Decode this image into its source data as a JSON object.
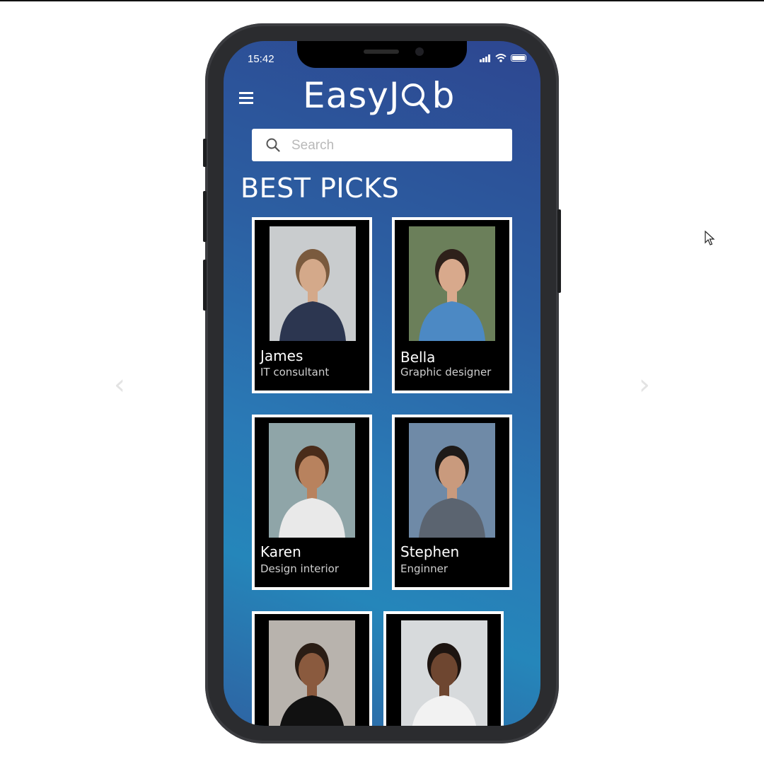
{
  "status": {
    "time": "15:42"
  },
  "app": {
    "logo": "EasyJob",
    "logo_prefix": "EasyJ",
    "logo_suffix": "b"
  },
  "search": {
    "placeholder": "Search",
    "value": ""
  },
  "section": {
    "title": "BEST PICKS"
  },
  "profiles": [
    {
      "name": "James",
      "role": "IT consultant",
      "photo_bg": "#c9ccce",
      "skin": "#d4a98a",
      "hair": "#7a5a3e",
      "shirt": "#2c3650"
    },
    {
      "name": "Bella",
      "role": "Graphic designer",
      "photo_bg": "#6b7f5a",
      "skin": "#d8a98c",
      "hair": "#2e201a",
      "shirt": "#4c89c4"
    },
    {
      "name": "Karen",
      "role": "Design interior",
      "photo_bg": "#8fa5a8",
      "skin": "#b8825e",
      "hair": "#4a2c1a",
      "shirt": "#e9e9e9"
    },
    {
      "name": "Stephen",
      "role": "Enginner",
      "photo_bg": "#6f8aa7",
      "skin": "#c99a7d",
      "hair": "#1e1a18",
      "shirt": "#5b6470"
    },
    {
      "name": "",
      "role": "",
      "photo_bg": "#b8b3ad",
      "skin": "#8a5a3e",
      "hair": "#2a1d15",
      "shirt": "#111111"
    },
    {
      "name": "",
      "role": "",
      "photo_bg": "#d7dadc",
      "skin": "#6e4630",
      "hair": "#1d1410",
      "shirt": "#f2f2f2"
    }
  ],
  "icons": {
    "menu": "hamburger-icon",
    "search": "search-icon",
    "signal": "signal-icon",
    "wifi": "wifi-icon",
    "battery": "battery-icon",
    "prev": "chevron-left-icon",
    "next": "chevron-right-icon",
    "cursor": "mouse-cursor-icon"
  }
}
